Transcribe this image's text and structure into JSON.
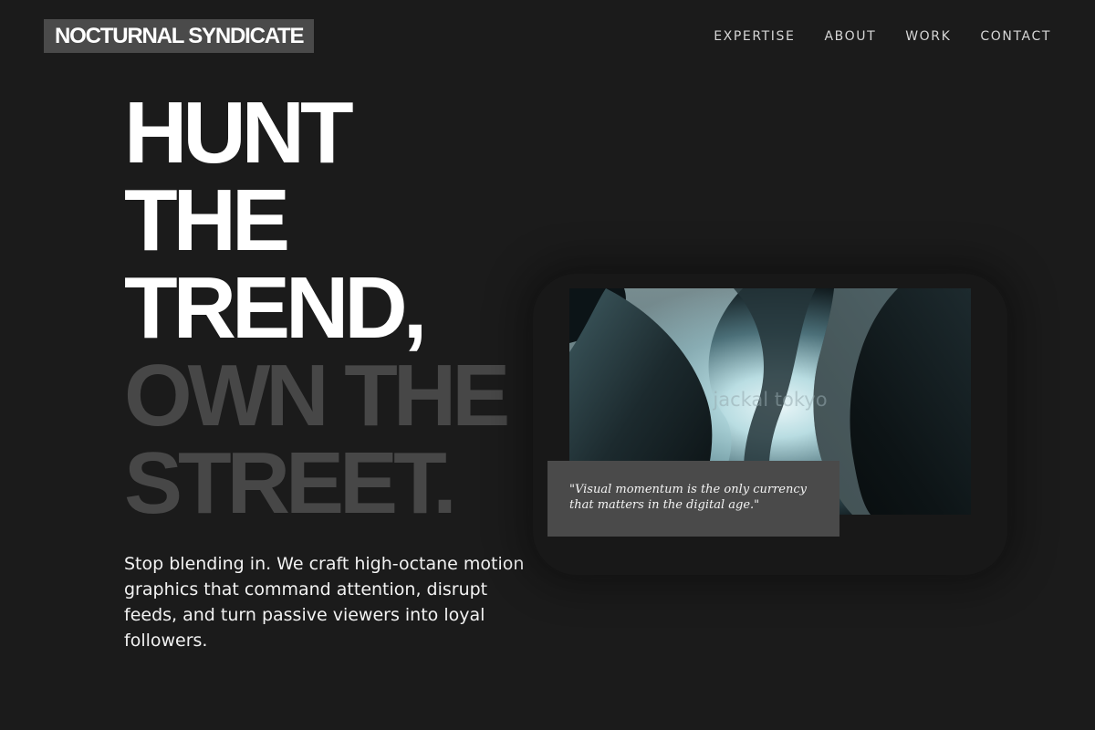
{
  "header": {
    "logo": "NOCTURNAL SYNDICATE",
    "nav": [
      {
        "label": "EXPERTISE"
      },
      {
        "label": "ABOUT"
      },
      {
        "label": "WORK"
      },
      {
        "label": "CONTACT"
      }
    ]
  },
  "hero": {
    "headline_white": [
      "HUNT",
      "THE",
      "TREND,"
    ],
    "headline_grey": [
      "OWN THE",
      "STREET."
    ],
    "intro": "Stop blending in. We craft high-octane motion graphics that command attention, disrupt feeds, and turn passive viewers into loyal followers."
  },
  "visual": {
    "alt_text": "jackal tokyo",
    "quote": "\"Visual momentum is the only currency that matters in the digital age.\""
  },
  "colors": {
    "background": "#1b1b1b",
    "logo_bg": "#4a4a4a",
    "headline_primary": "#ffffff",
    "headline_secondary": "#474747",
    "quote_bg": "#4a4a4a"
  }
}
